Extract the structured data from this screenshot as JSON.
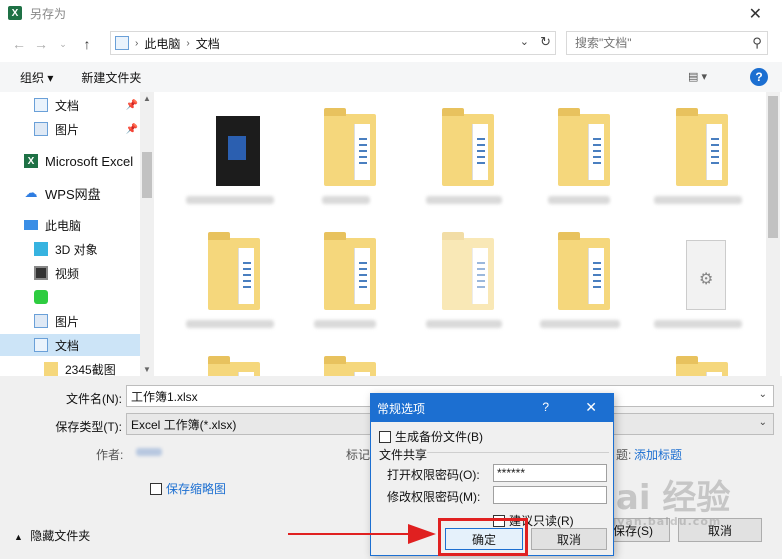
{
  "window": {
    "title": "另存为",
    "app_icon": "X"
  },
  "address": {
    "crumbs": [
      "此电脑",
      "文档"
    ],
    "search_placeholder": "搜索\"文档\""
  },
  "toolbar": {
    "organize": "组织 ▾",
    "new_folder": "新建文件夹"
  },
  "sidebar": {
    "items": [
      {
        "label": "文档",
        "icon": "document-icon",
        "pinned": true
      },
      {
        "label": "图片",
        "icon": "picture-icon",
        "pinned": true
      },
      {
        "label": "Microsoft Excel",
        "icon": "excel-icon"
      },
      {
        "label": "WPS网盘",
        "icon": "cloud-icon"
      },
      {
        "label": "此电脑",
        "icon": "computer-icon"
      },
      {
        "label": "3D 对象",
        "icon": "3d-icon"
      },
      {
        "label": "视频",
        "icon": "video-icon"
      },
      {
        "label": "",
        "icon": "app-icon"
      },
      {
        "label": "图片",
        "icon": "picture-icon"
      },
      {
        "label": "文档",
        "icon": "document-icon",
        "selected": true
      },
      {
        "label": "2345截图",
        "icon": "folder-icon"
      }
    ]
  },
  "form": {
    "filename_label": "文件名(N):",
    "filename_value": "工作簿1.xlsx",
    "filetype_label": "保存类型(T):",
    "filetype_value": "Excel 工作簿(*.xlsx)",
    "author_label": "作者:",
    "tags_label": "标记:",
    "title_label": "题:",
    "add_title": "添加标题",
    "save_thumbnail": "保存缩略图",
    "hide_folders": "隐藏文件夹",
    "save_button": "保存(S)",
    "cancel_button": "取消"
  },
  "dialog": {
    "title": "常规选项",
    "help": "?",
    "backup_label": "生成备份文件(B)",
    "sharing_label": "文件共享",
    "open_pwd_label": "打开权限密码(O):",
    "open_pwd_value": "******",
    "modify_pwd_label": "修改权限密码(M):",
    "modify_pwd_value": "",
    "readonly_label": "建议只读(R)",
    "ok": "确定",
    "cancel": "取消"
  },
  "watermark": {
    "text": "Bai 经验",
    "sub": "jingyan.baidu.com"
  }
}
